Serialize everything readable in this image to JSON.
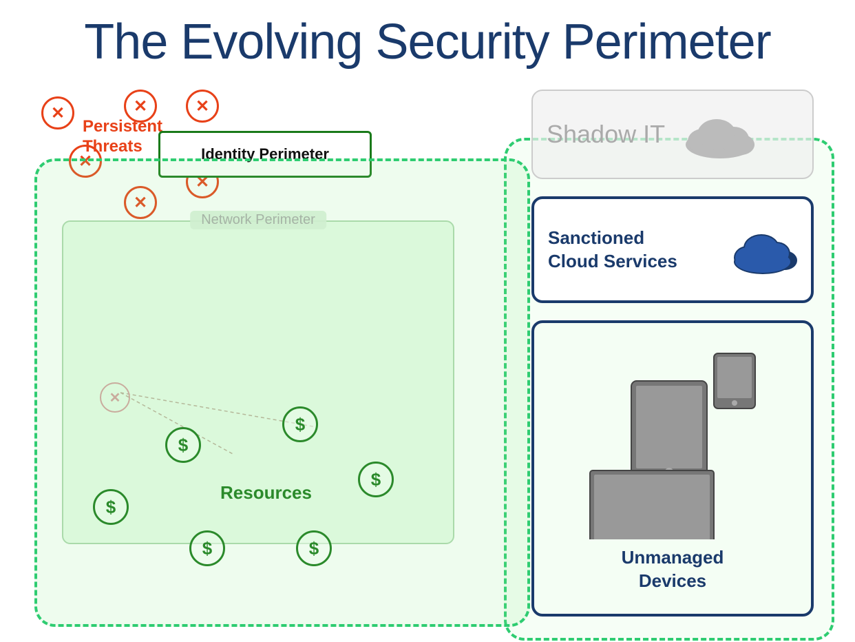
{
  "title": "The Evolving Security Perimeter",
  "threats": {
    "label_line1": "Persistent",
    "label_line2": "Threats"
  },
  "identity_perimeter": {
    "label": "Identity Perimeter"
  },
  "network_perimeter": {
    "label": "Network Perimeter"
  },
  "resources": {
    "label": "Resources"
  },
  "shadow_it": {
    "label": "Shadow IT"
  },
  "sanctioned": {
    "label_line1": "Sanctioned",
    "label_line2": "Cloud Services"
  },
  "unmanaged": {
    "label_line1": "Unmanaged",
    "label_line2": "Devices"
  },
  "colors": {
    "dark_blue": "#1a3a6b",
    "dark_green": "#1a7a1a",
    "bright_green": "#2ecc71",
    "red": "#e84118",
    "gray": "#aaaaaa"
  },
  "icons": {
    "threat": "✕",
    "dollar": "$",
    "cloud_blue_unicode": "☁"
  }
}
